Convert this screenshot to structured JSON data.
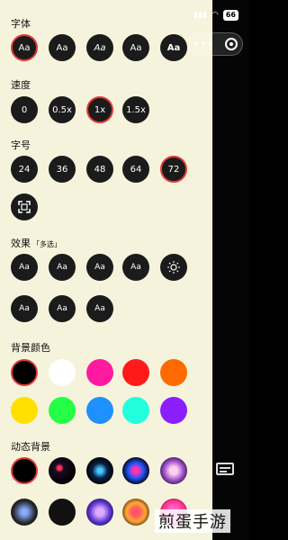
{
  "status": {
    "battery": "66"
  },
  "sections": {
    "font": {
      "label": "字体",
      "items": [
        "Aa",
        "Aa",
        "Aa",
        "Aa",
        "Aa"
      ]
    },
    "speed": {
      "label": "速度",
      "items": [
        "0",
        "0.5x",
        "1x",
        "1.5x"
      ],
      "selected": "1x"
    },
    "size": {
      "label": "字号",
      "items": [
        "24",
        "36",
        "48",
        "64",
        "72"
      ],
      "selected": "72"
    },
    "effects": {
      "label": "效果",
      "sublabel": "「多选」",
      "items": [
        "Aa",
        "Aa",
        "Aa",
        "Aa",
        "Aa",
        "Aa",
        "Aa"
      ]
    },
    "background_color": {
      "label": "背景颜色",
      "colors": [
        "#000000",
        "#ffffff",
        "#ff1aa0",
        "#ff1a1a",
        "#ff6a00",
        "#ffe000",
        "#22ff44",
        "#1e90ff",
        "#22ffdd",
        "#8b1eff"
      ]
    },
    "dynamic_background": {
      "label": "动态背景"
    }
  },
  "watermark": "煎蛋手游"
}
